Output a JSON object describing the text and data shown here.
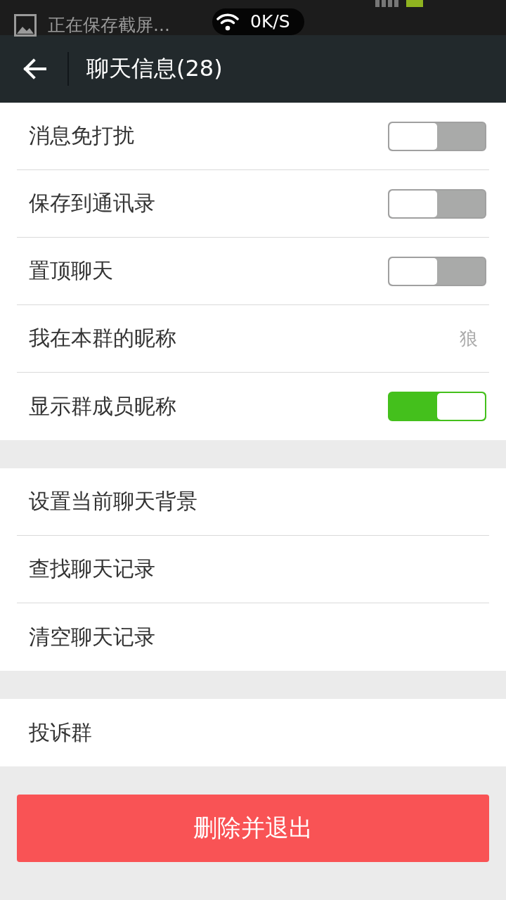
{
  "status_bar": {
    "notification": "正在保存截屏...",
    "speed": "0K/S"
  },
  "header": {
    "title": "聊天信息(28)"
  },
  "sections": [
    {
      "rows": [
        {
          "kind": "toggle",
          "label": "消息免打扰",
          "on": false
        },
        {
          "kind": "toggle",
          "label": "保存到通讯录",
          "on": false
        },
        {
          "kind": "toggle",
          "label": "置顶聊天",
          "on": false
        },
        {
          "kind": "value",
          "label": "我在本群的昵称",
          "value": "狼"
        },
        {
          "kind": "toggle",
          "label": "显示群成员昵称",
          "on": true
        }
      ]
    },
    {
      "rows": [
        {
          "kind": "plain",
          "label": "设置当前聊天背景"
        },
        {
          "kind": "plain",
          "label": "查找聊天记录"
        },
        {
          "kind": "plain",
          "label": "清空聊天记录"
        }
      ]
    },
    {
      "rows": [
        {
          "kind": "plain",
          "label": "投诉群"
        }
      ]
    }
  ],
  "delete_button": {
    "label": "删除并退出"
  }
}
